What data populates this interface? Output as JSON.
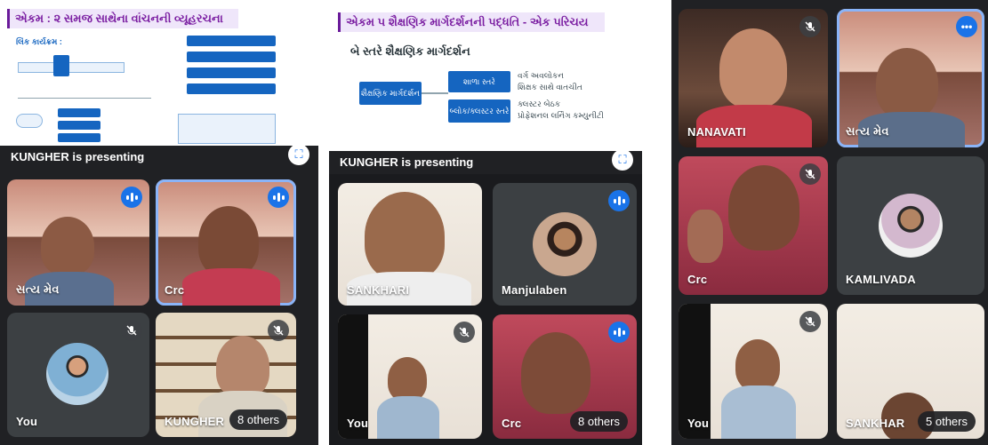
{
  "screens": [
    {
      "presentation": {
        "slide_title": "એકમ : ૨ સમજ સાથેના વાંચનની વ્યૂહરચના",
        "presenting_label": "KUNGHER is presenting"
      },
      "tiles": [
        {
          "name": "સત્ય મેવ",
          "status": "speaking"
        },
        {
          "name": "Crc",
          "status": "speaking"
        },
        {
          "name": "You",
          "status": "muted"
        },
        {
          "name": "KUNGHER",
          "status": "muted",
          "others": "8 others"
        }
      ]
    },
    {
      "presentation": {
        "slide_title": "એકમ ૫ શૈક્ષણિક માર્ગદર્શનની પદ્ધતિ - એક પરિચય",
        "slide_heading": "બે સ્તરે શૈક્ષણિક માર્ગદર્શન",
        "center_box": "શૈક્ષણિક માર્ગદર્શન",
        "box_a": "શાળા સ્તરે",
        "box_b": "બ્લોક/ક્લસ્ટર સ્તરે",
        "bullets_a": [
          "વર્ગ અવલોકન",
          "શિક્ષક સાથે વાતચીત"
        ],
        "bullets_b": [
          "ક્લસ્ટર બેઠક",
          "પ્રોફેશનલ લર્નિંગ કમ્યુનીટી"
        ],
        "presenting_label": "KUNGHER is presenting"
      },
      "tiles": [
        {
          "name": "SANKHARI",
          "status": "none"
        },
        {
          "name": "Manjulaben",
          "status": "speaking"
        },
        {
          "name": "You",
          "status": "muted"
        },
        {
          "name": "Crc",
          "status": "speaking",
          "others": "8 others"
        }
      ]
    },
    {
      "tiles": [
        {
          "name": "NANAVATI",
          "status": "muted"
        },
        {
          "name": "સત્ય મેવ",
          "status": "more"
        },
        {
          "name": "Crc",
          "status": "muted"
        },
        {
          "name": "KAMLIVADA",
          "status": "none"
        },
        {
          "name": "You",
          "status": "muted"
        },
        {
          "name": "SANKHAR",
          "status": "none",
          "others": "5 others"
        }
      ]
    }
  ],
  "colors": {
    "speaking": "#1a73e8",
    "active_outline": "#8ab4f8",
    "tile_bg": "#3c4043",
    "slide_title": "#7b1fa2"
  },
  "icons": {
    "muted": "mic-off-icon",
    "speaking": "audio-level-icon",
    "more": "more-options-icon",
    "fullscreen": "fullscreen-icon"
  }
}
